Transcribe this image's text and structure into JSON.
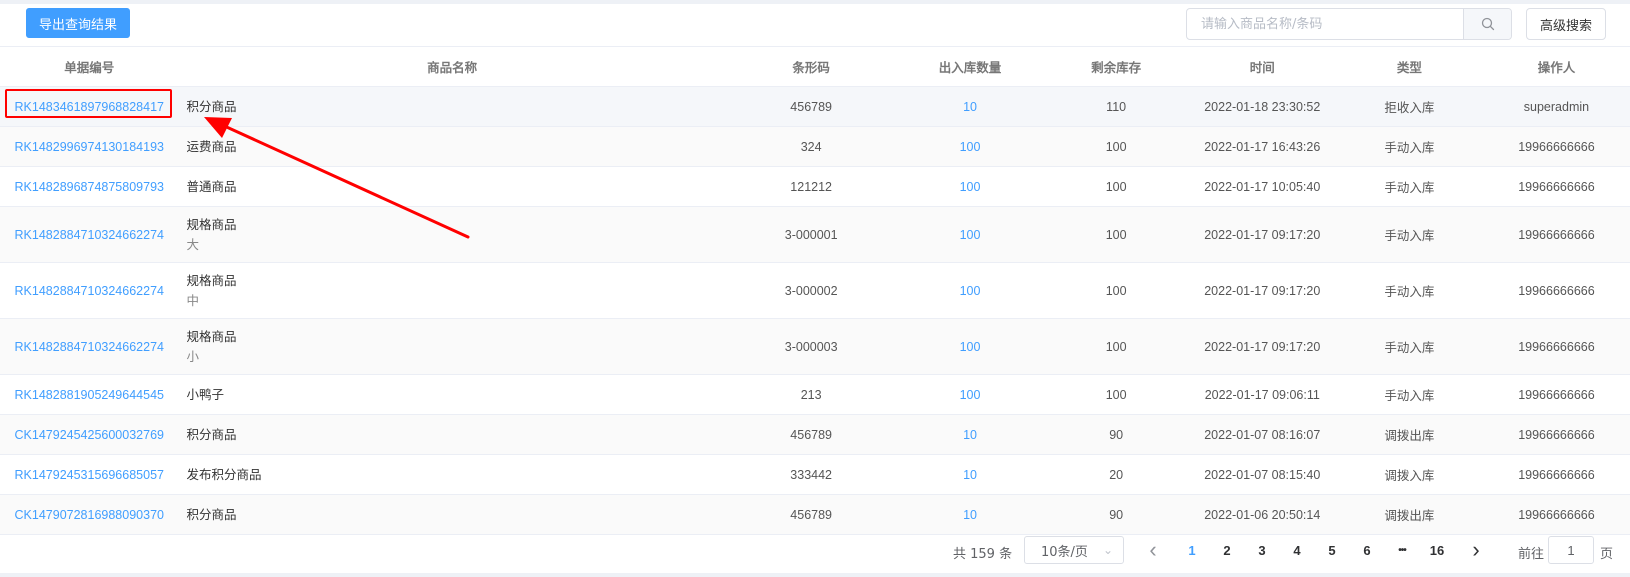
{
  "toolbar": {
    "export_label": "导出查询结果",
    "search_placeholder": "请输入商品名称/条码",
    "search_value": "",
    "advanced_label": "高级搜索",
    "search_icon": "search-icon"
  },
  "table": {
    "headers": {
      "no": "单据编号",
      "name": "商品名称",
      "barcode": "条形码",
      "qty": "出入库数量",
      "stock": "剩余库存",
      "time": "时间",
      "type": "类型",
      "operator": "操作人"
    },
    "rows": [
      {
        "no": "RK1483461897968828417",
        "name": "积分商品",
        "spec": "",
        "barcode": "456789",
        "qty": "10",
        "stock": "110",
        "time": "2022-01-18 23:30:52",
        "type": "拒收入库",
        "operator": "superadmin"
      },
      {
        "no": "RK1482996974130184193",
        "name": "运费商品",
        "spec": "",
        "barcode": "324",
        "qty": "100",
        "stock": "100",
        "time": "2022-01-17 16:43:26",
        "type": "手动入库",
        "operator": "19966666666"
      },
      {
        "no": "RK1482896874875809793",
        "name": "普通商品",
        "spec": "",
        "barcode": "121212",
        "qty": "100",
        "stock": "100",
        "time": "2022-01-17 10:05:40",
        "type": "手动入库",
        "operator": "19966666666"
      },
      {
        "no": "RK1482884710324662274",
        "name": "规格商品",
        "spec": "大",
        "barcode": "3-000001",
        "qty": "100",
        "stock": "100",
        "time": "2022-01-17 09:17:20",
        "type": "手动入库",
        "operator": "19966666666"
      },
      {
        "no": "RK1482884710324662274",
        "name": "规格商品",
        "spec": "中",
        "barcode": "3-000002",
        "qty": "100",
        "stock": "100",
        "time": "2022-01-17 09:17:20",
        "type": "手动入库",
        "operator": "19966666666"
      },
      {
        "no": "RK1482884710324662274",
        "name": "规格商品",
        "spec": "小",
        "barcode": "3-000003",
        "qty": "100",
        "stock": "100",
        "time": "2022-01-17 09:17:20",
        "type": "手动入库",
        "operator": "19966666666"
      },
      {
        "no": "RK1482881905249644545",
        "name": "小鸭子",
        "spec": "",
        "barcode": "213",
        "qty": "100",
        "stock": "100",
        "time": "2022-01-17 09:06:11",
        "type": "手动入库",
        "operator": "19966666666"
      },
      {
        "no": "CK1479245425600032769",
        "name": "积分商品",
        "spec": "",
        "barcode": "456789",
        "qty": "10",
        "stock": "90",
        "time": "2022-01-07 08:16:07",
        "type": "调拨出库",
        "operator": "19966666666"
      },
      {
        "no": "RK1479245315696685057",
        "name": "发布积分商品",
        "spec": "",
        "barcode": "333442",
        "qty": "10",
        "stock": "20",
        "time": "2022-01-07 08:15:40",
        "type": "调拨入库",
        "operator": "19966666666"
      },
      {
        "no": "CK1479072816988090370",
        "name": "积分商品",
        "spec": "",
        "barcode": "456789",
        "qty": "10",
        "stock": "90",
        "time": "2022-01-06 20:50:14",
        "type": "调拨出库",
        "operator": "19966666666"
      }
    ]
  },
  "pagination": {
    "total_text": "共 159 条",
    "page_size": "10条/页",
    "pages": [
      "1",
      "2",
      "3",
      "4",
      "5",
      "6"
    ],
    "ellipsis": "•••",
    "last_page": "16",
    "current_page": "1",
    "goto_prefix": "前往",
    "goto_value": "1",
    "goto_suffix": "页",
    "prev_icon": "‹",
    "next_icon": "›",
    "dropdown_icon": "⌄"
  },
  "colors": {
    "primary": "#409eff",
    "annotation": "#ff0000"
  }
}
